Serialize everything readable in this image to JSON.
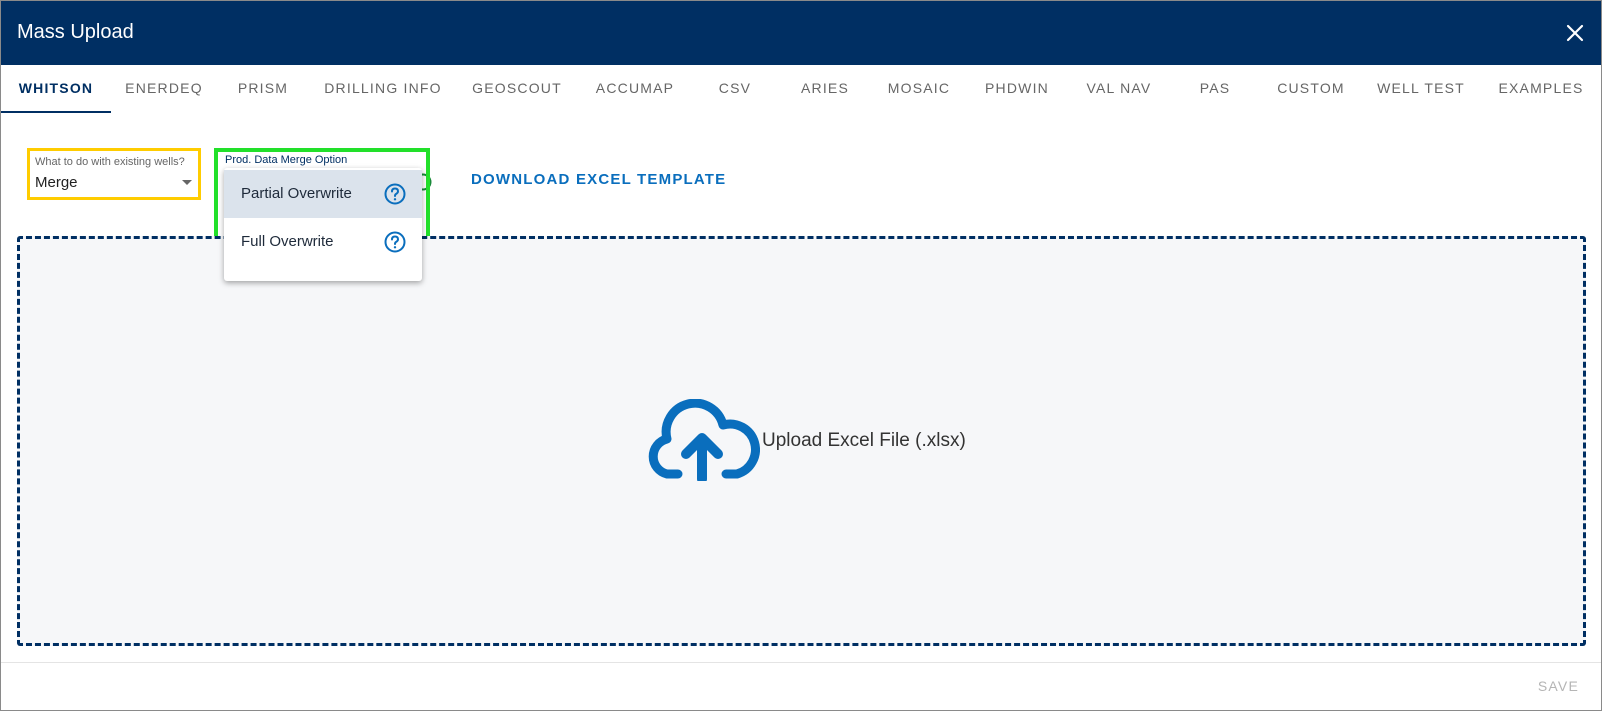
{
  "dialog": {
    "title": "Mass Upload"
  },
  "tabs": [
    {
      "label": "WHITSON",
      "active": true
    },
    {
      "label": "ENERDEQ"
    },
    {
      "label": "PRISM"
    },
    {
      "label": "DRILLING INFO"
    },
    {
      "label": "GEOSCOUT"
    },
    {
      "label": "ACCUMAP"
    },
    {
      "label": "CSV"
    },
    {
      "label": "ARIES"
    },
    {
      "label": "MOSAIC"
    },
    {
      "label": "PHDWIN"
    },
    {
      "label": "VAL NAV"
    },
    {
      "label": "PAS"
    },
    {
      "label": "CUSTOM"
    },
    {
      "label": "WELL TEST"
    },
    {
      "label": "EXAMPLES"
    }
  ],
  "existing_wells": {
    "label": "What to do with existing wells?",
    "value": "Merge"
  },
  "merge_option": {
    "label": "Prod. Data Merge Option",
    "options": [
      {
        "label": "Partial Overwrite",
        "selected": true
      },
      {
        "label": "Full Overwrite"
      }
    ]
  },
  "download_template": {
    "label": "DOWNLOAD EXCEL TEMPLATE"
  },
  "upload": {
    "label": "Upload Excel File (.xlsx)"
  },
  "footer": {
    "save_label": "SAVE"
  },
  "colors": {
    "header": "#002f63",
    "accent": "#0a6ebd",
    "highlight_yellow": "#ffcc00",
    "highlight_green": "#22e02a"
  }
}
